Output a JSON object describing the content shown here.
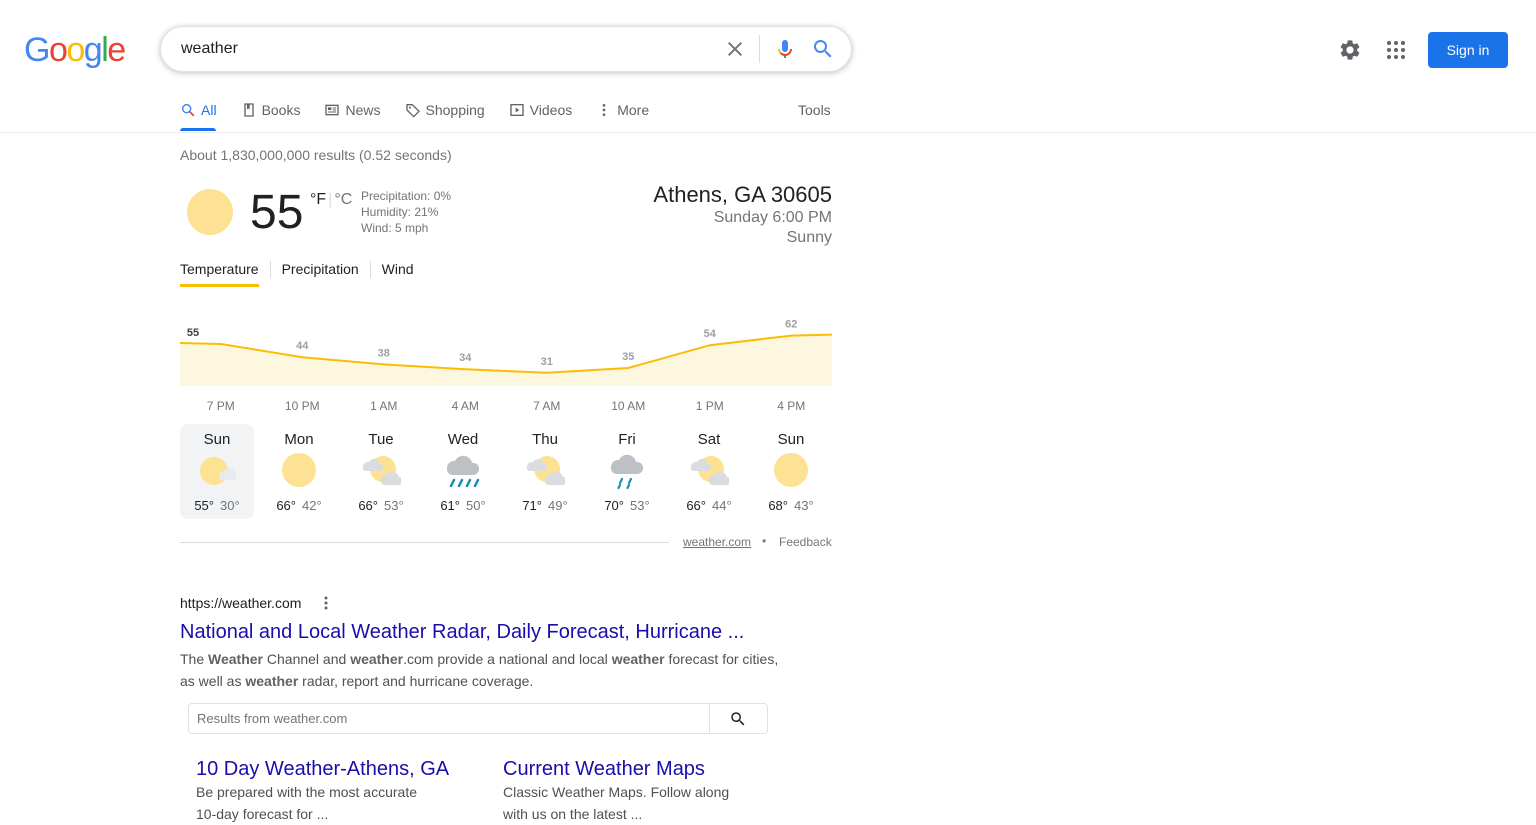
{
  "logo": {
    "letters": [
      "G",
      "o",
      "o",
      "g",
      "l",
      "e"
    ],
    "colors": [
      "#4285f4",
      "#ea4335",
      "#fbbc05",
      "#4285f4",
      "#34a853",
      "#ea4335"
    ]
  },
  "search": {
    "query": "weather"
  },
  "header": {
    "signin_label": "Sign in"
  },
  "tabs": [
    {
      "label": "All",
      "icon": "search-icon",
      "active": true
    },
    {
      "label": "Books",
      "icon": "book-icon"
    },
    {
      "label": "News",
      "icon": "news-icon"
    },
    {
      "label": "Shopping",
      "icon": "tag-icon"
    },
    {
      "label": "Videos",
      "icon": "play-icon"
    },
    {
      "label": "More",
      "icon": "more-vert-icon"
    }
  ],
  "tools_label": "Tools",
  "stats": "About 1,830,000,000 results (0.52 seconds)",
  "weather": {
    "temp": "55",
    "unit_f": "°F",
    "unit_sep": "|",
    "unit_c": "°C",
    "precipitation": "Precipitation: 0%",
    "humidity": "Humidity: 21%",
    "wind": "Wind: 5 mph",
    "location": "Athens, GA 30605",
    "datetime": "Sunday 6:00 PM",
    "condition": "Sunny",
    "tabs": [
      "Temperature",
      "Precipitation",
      "Wind"
    ],
    "source_link": "weather.com",
    "separator": "•",
    "feedback": "Feedback",
    "accent": "#fbbc04",
    "fill": "#fef7e0"
  },
  "chart_data": {
    "type": "area",
    "labels": [
      "55",
      "44",
      "38",
      "34",
      "31",
      "35",
      "54",
      "62"
    ],
    "values": [
      55,
      44,
      38,
      34,
      31,
      35,
      54,
      62
    ],
    "x_ticks": [
      "7 PM",
      "10 PM",
      "1 AM",
      "4 AM",
      "7 AM",
      "10 AM",
      "1 PM",
      "4 PM"
    ]
  },
  "forecast": [
    {
      "day": "Sun",
      "icon": "partly-sunny-icon",
      "hi": "55°",
      "lo": "30°",
      "selected": true
    },
    {
      "day": "Mon",
      "icon": "sunny-icon",
      "hi": "66°",
      "lo": "42°"
    },
    {
      "day": "Tue",
      "icon": "partly-cloudy-icon",
      "hi": "66°",
      "lo": "53°"
    },
    {
      "day": "Wed",
      "icon": "rain-icon",
      "hi": "61°",
      "lo": "50°"
    },
    {
      "day": "Thu",
      "icon": "partly-cloudy-icon",
      "hi": "71°",
      "lo": "49°"
    },
    {
      "day": "Fri",
      "icon": "showers-icon",
      "hi": "70°",
      "lo": "53°"
    },
    {
      "day": "Sat",
      "icon": "partly-cloudy-icon",
      "hi": "66°",
      "lo": "44°"
    },
    {
      "day": "Sun",
      "icon": "sunny-icon",
      "hi": "68°",
      "lo": "43°"
    }
  ],
  "result": {
    "url": "https://weather.com",
    "title": "National and Local Weather Radar, Daily Forecast, Hurricane ...",
    "snippet_parts": [
      {
        "t": "The ",
        "b": false
      },
      {
        "t": "Weather",
        "b": true
      },
      {
        "t": " Channel and ",
        "b": false
      },
      {
        "t": "weather",
        "b": true
      },
      {
        "t": ".com provide a national and local ",
        "b": false
      },
      {
        "t": "weather",
        "b": true
      },
      {
        "t": " forecast for cities, as well as ",
        "b": false
      },
      {
        "t": "weather",
        "b": true
      },
      {
        "t": " radar, report and hurricane coverage.",
        "b": false
      }
    ],
    "site_search_placeholder": "Results from weather.com",
    "sitelinks": [
      {
        "title": "10 Day Weather-Athens, GA",
        "desc": "Be prepared with the most accurate 10-day forecast for ..."
      },
      {
        "title": "Current Weather Maps",
        "desc": "Classic Weather Maps. Follow along with us on the latest ..."
      }
    ]
  }
}
